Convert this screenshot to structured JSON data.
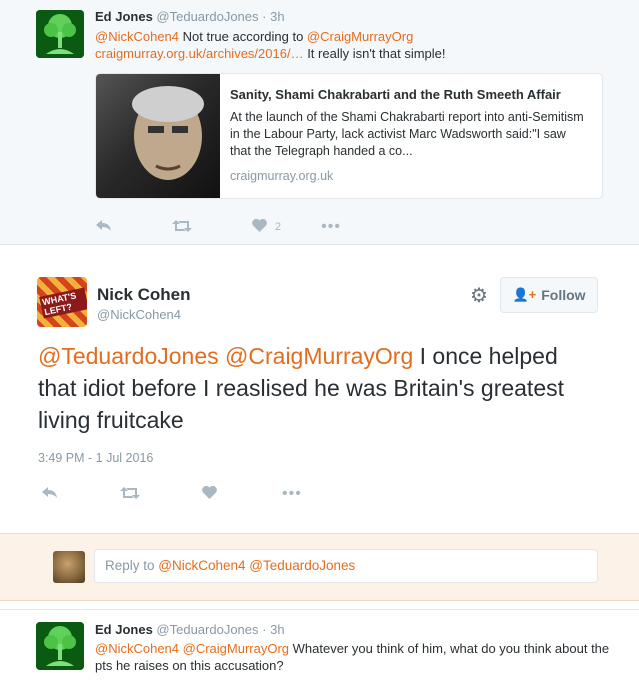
{
  "top_tweet": {
    "name": "Ed Jones",
    "handle": "@TeduardoJones",
    "time": "· 3h",
    "mention": "@NickCohen4",
    "text_1": " Not true according to ",
    "mention_2": "@CraigMurrayOrg",
    "link": "craigmurray.org.uk/archives/2016/…",
    "text_2": " It really isn't that simple!",
    "card": {
      "title": "Sanity, Shami Chakrabarti and the Ruth Smeeth Affair",
      "description": "At the launch of the Shami Chakrabarti report into anti-Semitism in the Labour Party, lack activist Marc Wadsworth said:\"I saw that the Telegraph handed a co...",
      "domain": "craigmurray.org.uk"
    },
    "like_count": "2"
  },
  "main_tweet": {
    "name": "Nick Cohen",
    "handle": "@NickCohen4",
    "follow_label": "Follow",
    "mention_1": "@TeduardoJones",
    "mention_2": "@CraigMurrayOrg",
    "text": " I once helped that idiot before I reaslised he was Britain's greatest living fruitcake",
    "timestamp": "3:49 PM - 1 Jul 2016"
  },
  "reply": {
    "prefix": "Reply to ",
    "mentions": "@NickCohen4 @TeduardoJones"
  },
  "bottom_tweet": {
    "name": "Ed Jones",
    "handle": "@TeduardoJones",
    "time": "· 3h",
    "mentions": "@NickCohen4 @CraigMurrayOrg",
    "text": " Whatever you think of him, what do you think about the pts he raises on this accusation?"
  },
  "avatar_badge": "WHAT'S LEFT?",
  "colors": {
    "accent": "#e36d1f",
    "muted": "#8899a6",
    "text": "#292f33"
  }
}
